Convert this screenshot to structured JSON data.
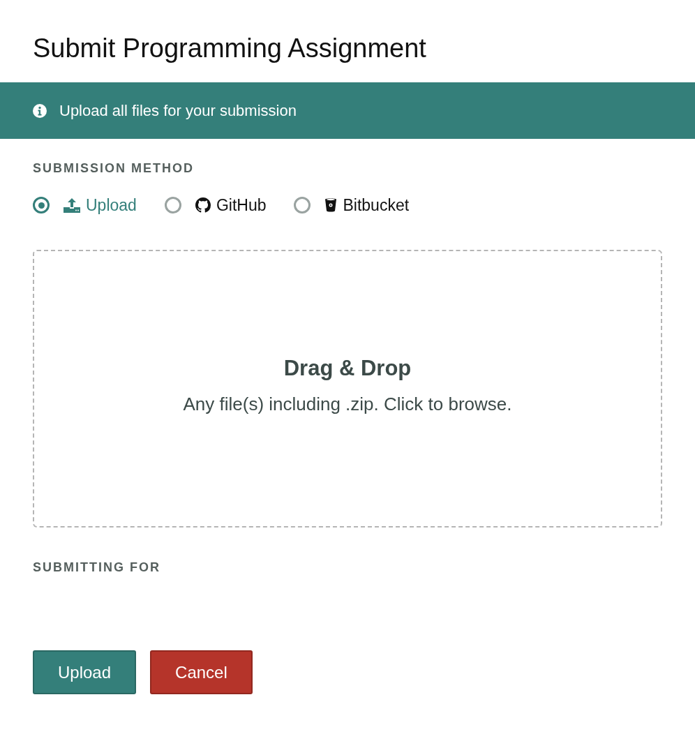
{
  "dialog": {
    "title": "Submit Programming Assignment"
  },
  "banner": {
    "text": "Upload all files for your submission"
  },
  "submission_method": {
    "label": "SUBMISSION METHOD",
    "options": [
      {
        "label": "Upload",
        "kind": "upload",
        "selected": true
      },
      {
        "label": "GitHub",
        "kind": "github",
        "selected": false
      },
      {
        "label": "Bitbucket",
        "kind": "bitbucket",
        "selected": false
      }
    ]
  },
  "dropzone": {
    "title": "Drag & Drop",
    "hint": "Any file(s) including .zip. Click to browse."
  },
  "submitting_for": {
    "label": "SUBMITTING FOR"
  },
  "buttons": [
    {
      "label": "Upload",
      "kind": "primary"
    },
    {
      "label": "Cancel",
      "kind": "danger"
    }
  ]
}
